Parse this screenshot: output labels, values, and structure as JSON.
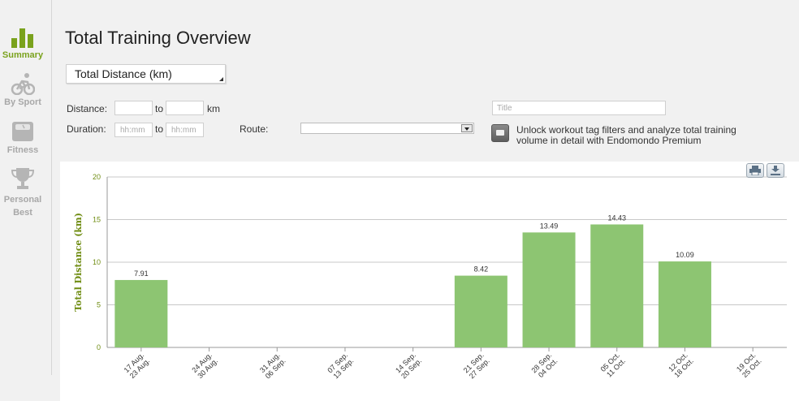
{
  "nav": {
    "items": [
      {
        "label": "Summary",
        "icon": "bar-chart-icon",
        "active": true
      },
      {
        "label": "By Sport",
        "icon": "cyclist-icon",
        "active": false
      },
      {
        "label": "Fitness",
        "icon": "scale-icon",
        "active": false
      },
      {
        "label": "Personal Best",
        "icon": "trophy-icon",
        "active": false
      }
    ],
    "summary_label": "Summary",
    "sport_label": "By Sport",
    "fitness_label": "Fitness",
    "best_label_1": "Personal",
    "best_label_2": "Best"
  },
  "page": {
    "title": "Total Training Overview"
  },
  "metric_select": {
    "value": "Total Distance (km)"
  },
  "filters": {
    "distance_label": "Distance:",
    "to_label": "to",
    "km_label": "km",
    "duration_label": "Duration:",
    "duration_placeholder": "hh:mm",
    "route_label": "Route:",
    "route_value": "",
    "title_placeholder": "Title"
  },
  "premium": {
    "text": "Unlock workout tag filters and analyze total training volume in detail with Endomondo Premium"
  },
  "colors": {
    "accent": "#7aa21d",
    "bar": "#8dc572",
    "bar_label": "#333333",
    "axis_label": "#6f8c12"
  },
  "chart_data": {
    "type": "bar",
    "ylabel": "Total Distance (km)",
    "ylim": [
      0,
      20
    ],
    "yticks": [
      "0",
      "5",
      "10",
      "15",
      "20"
    ],
    "grid": true,
    "categories": [
      [
        "17 Aug.",
        "23 Aug."
      ],
      [
        "24 Aug.",
        "30 Aug."
      ],
      [
        "31 Aug.",
        "06 Sep."
      ],
      [
        "07 Sep.",
        "13 Sep."
      ],
      [
        "14 Sep.",
        "20 Sep."
      ],
      [
        "21 Sep.",
        "27 Sep."
      ],
      [
        "28 Sep.",
        "04 Oct."
      ],
      [
        "05 Oct.",
        "11 Oct."
      ],
      [
        "12 Oct.",
        "18 Oct."
      ],
      [
        "19 Oct.",
        "25 Oct."
      ]
    ],
    "values": [
      7.91,
      null,
      null,
      null,
      null,
      8.42,
      13.49,
      14.43,
      10.09,
      null
    ],
    "value_labels": [
      "7.91",
      "",
      "",
      "",
      "",
      "8.42",
      "13.49",
      "14.43",
      "10.09",
      ""
    ]
  }
}
